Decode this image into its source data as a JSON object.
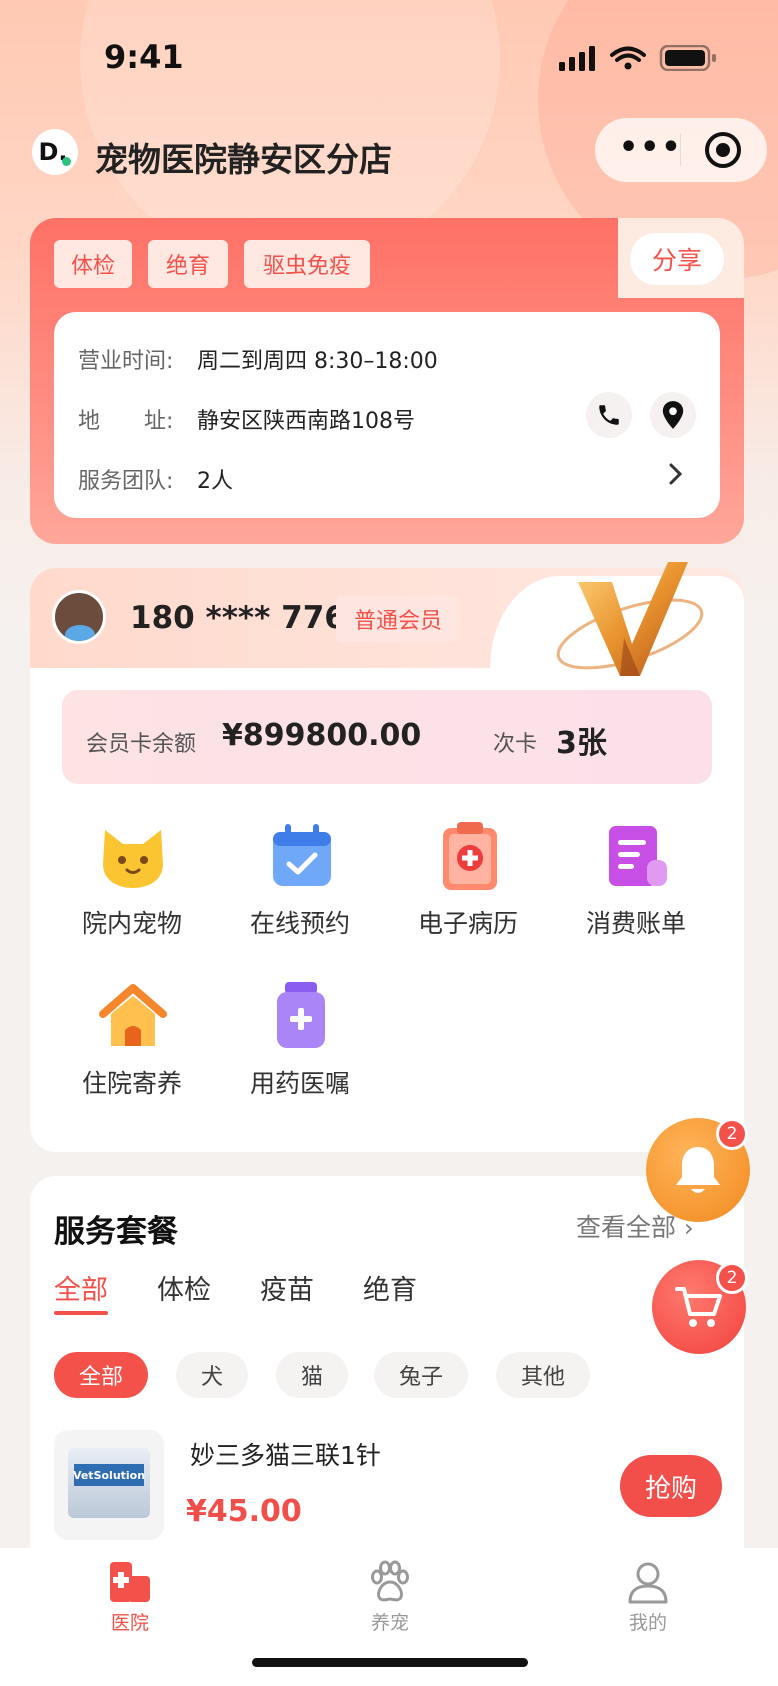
{
  "status_bar": {
    "time": "9:41"
  },
  "nav": {
    "logo_letter": "D.",
    "title": "宠物医院静安区分店"
  },
  "store": {
    "tags": [
      "体检",
      "绝育",
      "驱虫免疫"
    ],
    "share_label": "分享",
    "hours_label": "营业时间:",
    "hours_value": "周二到周四 8:30–18:00",
    "address_label": "地　　址:",
    "address_value": "静安区陕西南路108号",
    "team_label": "服务团队:",
    "team_value": "2人"
  },
  "member": {
    "phone": "180 **** 7766",
    "level": "普通会员",
    "balance_label": "会员卡余额",
    "balance_value": "¥899800.00",
    "cards_label": "次卡",
    "cards_value": "3张",
    "shortcuts": [
      "院内宠物",
      "在线预约",
      "电子病历",
      "消费账单",
      "住院寄养",
      "用药医嘱"
    ]
  },
  "fabs": {
    "bell_badge": "2",
    "cart_badge": "2"
  },
  "service": {
    "title": "服务套餐",
    "view_all": "查看全部",
    "tabs": [
      "全部",
      "体检",
      "疫苗",
      "绝育"
    ],
    "filters": [
      "全部",
      "犬",
      "猫",
      "兔子",
      "其他"
    ],
    "product": {
      "name": "妙三多猫三联1针",
      "price": "¥45.00",
      "buy_label": "抢购",
      "image_text": "VetSolution"
    }
  },
  "tabbar": {
    "items": [
      "医院",
      "养宠",
      "我的"
    ],
    "active_index": 0
  },
  "colors": {
    "accent": "#f4514a",
    "card_gradient_start": "#ff7166"
  }
}
